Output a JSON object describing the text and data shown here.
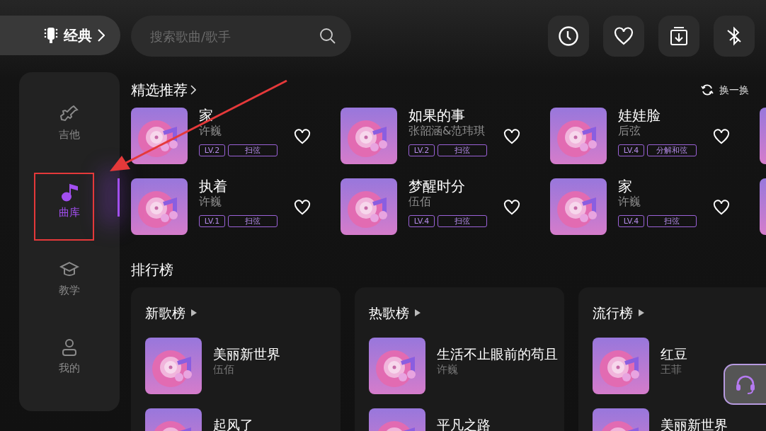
{
  "top_bar": {
    "mode_label": "经典",
    "search": {
      "placeholder": "搜索歌曲/歌手"
    }
  },
  "sidebar": {
    "items": [
      {
        "label": "吉他",
        "selected": false
      },
      {
        "label": "曲库",
        "selected": true
      },
      {
        "label": "教学",
        "selected": false
      },
      {
        "label": "我的",
        "selected": false
      }
    ]
  },
  "featured": {
    "title": "精选推荐",
    "refresh_label": "换一换",
    "songs": [
      {
        "title": "家",
        "artist": "许巍",
        "difficulty": "LV.2",
        "technique": "扫弦"
      },
      {
        "title": "如果的事",
        "artist": "张韶涵&范玮琪",
        "difficulty": "LV.2",
        "technique": "扫弦"
      },
      {
        "title": "娃娃脸",
        "artist": "后弦",
        "difficulty": "LV.4",
        "technique": "分解和弦"
      },
      {
        "title": "执着",
        "artist": "许巍",
        "difficulty": "LV.1",
        "technique": "扫弦"
      },
      {
        "title": "梦醒时分",
        "artist": "伍佰",
        "difficulty": "LV.4",
        "technique": "扫弦"
      },
      {
        "title": "家",
        "artist": "许巍",
        "difficulty": "LV.4",
        "technique": "扫弦"
      }
    ]
  },
  "charts": {
    "title": "排行榜",
    "lists": [
      {
        "name": "新歌榜",
        "songs": [
          {
            "title": "美丽新世界",
            "artist": "伍佰"
          },
          {
            "title": "起风了"
          }
        ]
      },
      {
        "name": "热歌榜",
        "songs": [
          {
            "title": "生活不止眼前的苟且",
            "artist": "许巍"
          },
          {
            "title": "平凡之路"
          }
        ]
      },
      {
        "name": "流行榜",
        "songs": [
          {
            "title": "红豆",
            "artist": "王菲"
          },
          {
            "title": "美丽新世界"
          }
        ]
      }
    ]
  }
}
